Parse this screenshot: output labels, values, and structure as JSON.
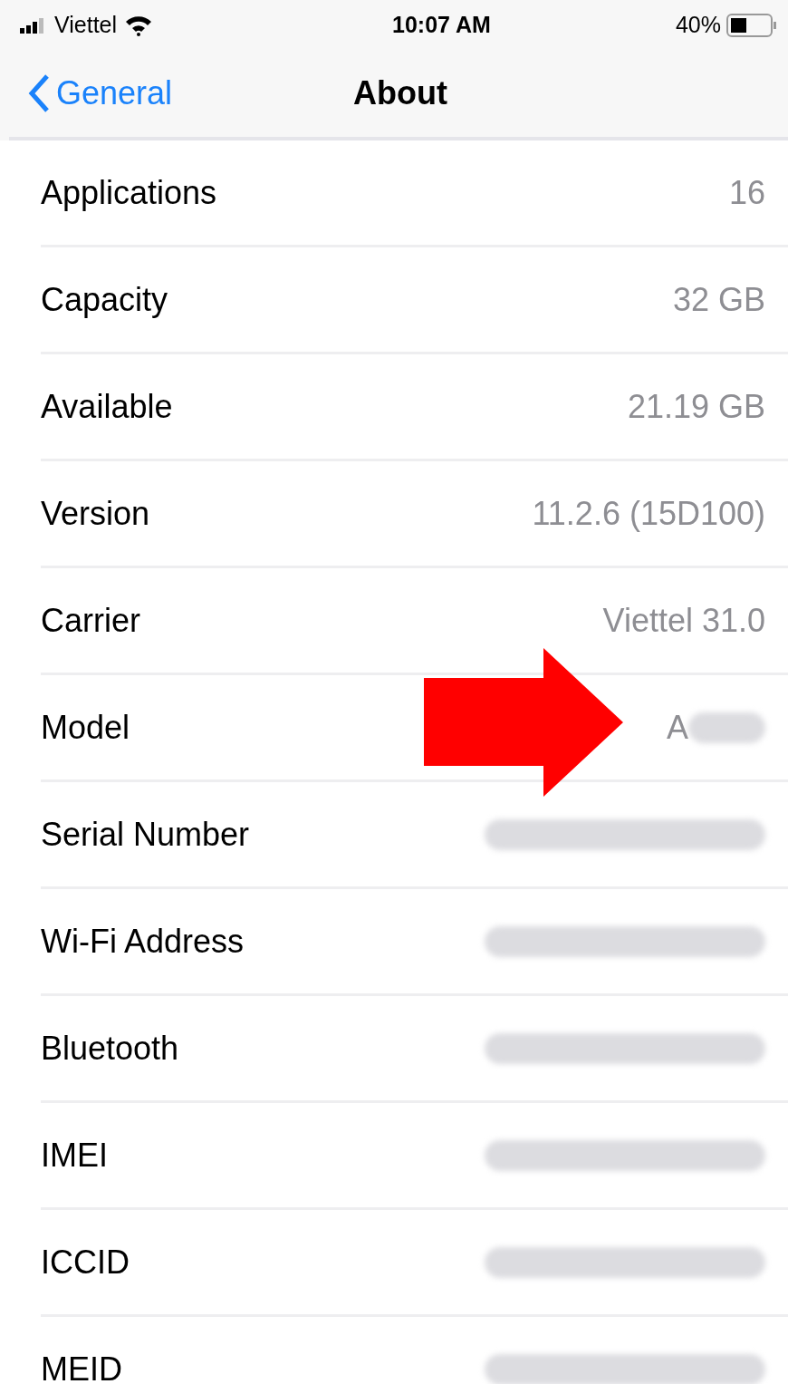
{
  "status_bar": {
    "carrier": "Viettel",
    "time": "10:07 AM",
    "battery": "40%"
  },
  "nav_bar": {
    "back": "General",
    "title": "About"
  },
  "rows": [
    {
      "label": "Applications",
      "kind": "plain",
      "value": "16"
    },
    {
      "label": "Capacity",
      "kind": "plain",
      "value": "32 GB"
    },
    {
      "label": "Available",
      "kind": "plain",
      "value": "21.19 GB"
    },
    {
      "label": "Version",
      "kind": "plain",
      "value": "11.2.6 (15D100)"
    },
    {
      "label": "Carrier",
      "kind": "plain",
      "value": "Viettel 31.0"
    },
    {
      "label": "Model",
      "kind": "partial",
      "value": "A"
    },
    {
      "label": "Serial Number",
      "kind": "redacted"
    },
    {
      "label": "Wi-Fi Address",
      "kind": "redacted"
    },
    {
      "label": "Bluetooth",
      "kind": "redacted"
    },
    {
      "label": "IMEI",
      "kind": "redacted"
    },
    {
      "label": "ICCID",
      "kind": "redacted"
    },
    {
      "label": "MEID",
      "kind": "redacted"
    }
  ]
}
